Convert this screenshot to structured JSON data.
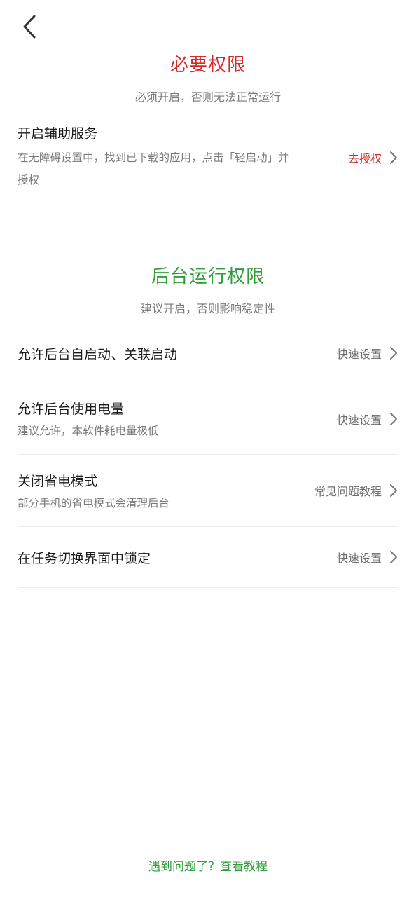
{
  "header": {
    "back_icon": "chevron-left-icon"
  },
  "required": {
    "title": "必要权限",
    "subtitle": "必须开启，否则无法正常运行",
    "title_color": "#d5282b",
    "items": [
      {
        "title": "开启辅助服务",
        "desc_line1": "在无障碍设置中，找到已下载的应用，点击「轻启动」并",
        "desc_line2": "授权",
        "action": "去授权",
        "action_color": "#d5282b"
      }
    ]
  },
  "background": {
    "title": "后台运行权限",
    "subtitle": "建议开启，否则影响稳定性",
    "title_color": "#2f9d3a",
    "items": [
      {
        "title": "允许后台自启动、关联启动",
        "action": "快速设置"
      },
      {
        "title": "允许后台使用电量",
        "desc": "建议允许，本软件耗电量极低",
        "action": "快速设置"
      },
      {
        "title": "关闭省电模式",
        "desc": "部分手机的省电模式会清理后台",
        "action": "常见问题教程"
      },
      {
        "title": "在任务切换界面中锁定",
        "action": "快速设置"
      }
    ]
  },
  "footer": {
    "link": "遇到问题了？查看教程",
    "link_color": "#2f9d3a"
  }
}
